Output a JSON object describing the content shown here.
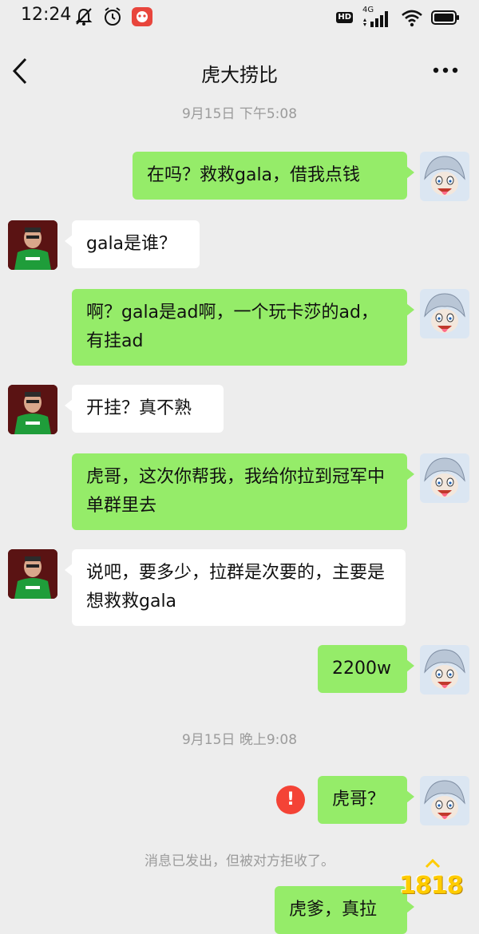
{
  "status_bar": {
    "time": "12:24",
    "hd": "HD",
    "network": "4G",
    "icons": [
      "mute-bell-icon",
      "alarm-icon",
      "app-notification-icon",
      "signal-icon",
      "wifi-icon",
      "battery-icon"
    ]
  },
  "header": {
    "title": "虎大捞比",
    "back_icon": "chevron-left-icon",
    "more_icon": "more-dots-icon"
  },
  "colors": {
    "background": "#ededed",
    "my_bubble": "#95ec69",
    "their_bubble": "#ffffff",
    "error": "#f44336",
    "timestamp_text": "#9b9b9b"
  },
  "messages": [
    {
      "type": "timestamp",
      "text": "9月15日 下午5:08"
    },
    {
      "from": "me",
      "text": "在吗？救救gala，借我点钱"
    },
    {
      "from": "them",
      "text": "gala是谁？"
    },
    {
      "from": "me",
      "text": "啊？gala是ad啊，一个玩卡莎的ad，有挂ad"
    },
    {
      "from": "them",
      "text": "开挂？真不熟"
    },
    {
      "from": "me",
      "text": "虎哥，这次你帮我，我给你拉到冠军中单群里去"
    },
    {
      "from": "them",
      "text": "说吧，要多少，拉群是次要的，主要是想救救gala"
    },
    {
      "from": "me",
      "text": "2200w"
    },
    {
      "type": "timestamp",
      "text": "9月15日 晚上9:08"
    },
    {
      "from": "me",
      "text": "虎哥？",
      "failed": true,
      "error_mark": "!"
    },
    {
      "type": "notice",
      "text": "消息已发出，但被对方拒收了。"
    },
    {
      "from": "me",
      "text": "虎爹，真拉",
      "partial": true
    }
  ],
  "watermark": "1818"
}
